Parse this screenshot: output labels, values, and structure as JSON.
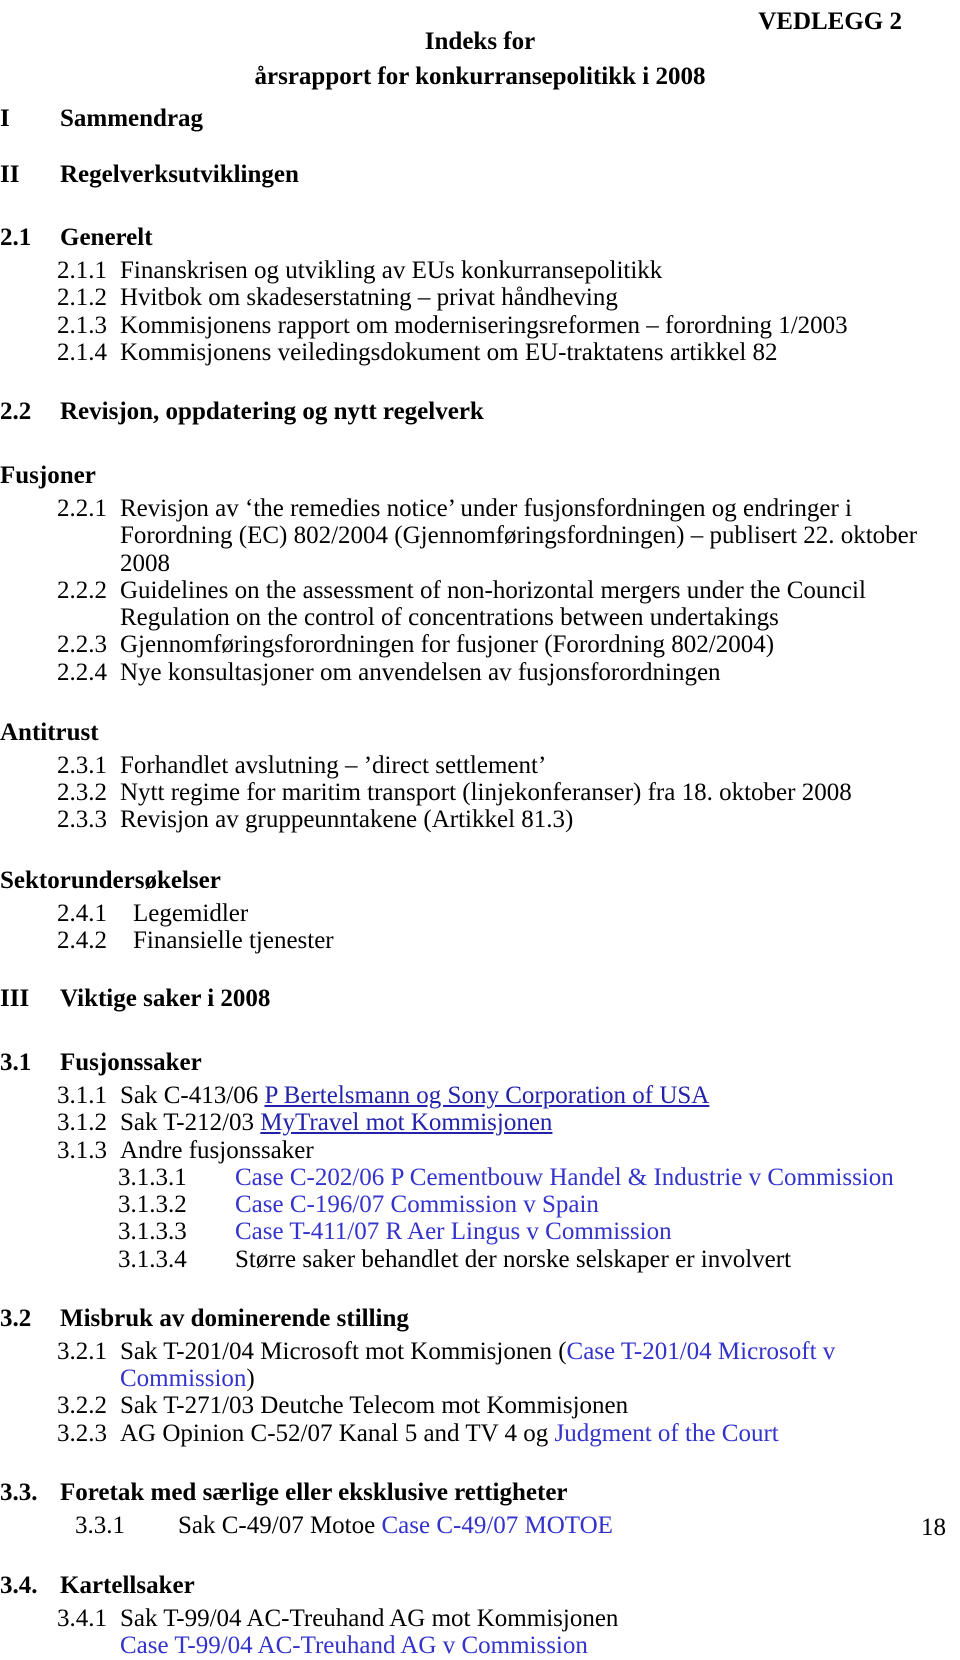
{
  "header": {
    "vedlegg": "VEDLEGG 2",
    "title_line1": "Indeks for",
    "title_line2": "årsrapport for konkurransepolitikk i 2008"
  },
  "colors": {
    "link_underlined": "#2222aa",
    "link_plain": "#3333cc",
    "text": "#000000",
    "background": "#ffffff"
  },
  "sections": {
    "roman_I": {
      "num": "I",
      "label": "Sammendrag"
    },
    "roman_II": {
      "num": "II",
      "label": "Regelverksutviklingen"
    },
    "roman_III": {
      "num": "III",
      "label": "Viktige saker i 2008"
    },
    "s21": {
      "num": "2.1",
      "label": "Generelt"
    },
    "s22": {
      "num": "2.2",
      "label": "Revisjon, oppdatering og nytt regelverk"
    },
    "s31": {
      "num": "3.1",
      "label": "Fusjonssaker"
    },
    "s32": {
      "num": "3.2",
      "label": "Misbruk av dominerende stilling"
    },
    "s33": {
      "num": "3.3.",
      "label": "Foretak med særlige eller eksklusive rettigheter"
    },
    "s34": {
      "num": "3.4.",
      "label": "Kartellsaker"
    }
  },
  "groups": {
    "fusjoner": "Fusjoner",
    "antitrust": "Antitrust",
    "sektor": "Sektorundersøkelser"
  },
  "items": {
    "i211": {
      "num": "2.1.1",
      "text": "Finanskrisen og utvikling av EUs konkurransepolitikk"
    },
    "i212": {
      "num": "2.1.2",
      "text": "Hvitbok om skadeserstatning – privat håndheving"
    },
    "i213": {
      "num": "2.1.3",
      "text": "Kommisjonens rapport om moderniseringsreformen – forordning 1/2003"
    },
    "i214": {
      "num": "2.1.4",
      "text": "Kommisjonens veiledingsdokument om EU-traktatens artikkel 82"
    },
    "i221": {
      "num": "2.2.1",
      "text": "Revisjon av ‘the remedies notice’ under fusjonsfordningen og endringer i Forordning (EC) 802/2004 (Gjennomføringsfordningen) – publisert 22. oktober 2008"
    },
    "i222": {
      "num": "2.2.2",
      "text": "Guidelines on the assessment of non-horizontal mergers under the Council Regulation on the control of concentrations between undertakings"
    },
    "i223": {
      "num": "2.2.3",
      "text": "Gjennomføringsforordningen for fusjoner (Forordning 802/2004)"
    },
    "i224": {
      "num": "2.2.4",
      "text": "Nye konsultasjoner om anvendelsen av fusjonsforordningen"
    },
    "i231": {
      "num": "2.3.1",
      "text": "Forhandlet avslutning – ’direct settlement’"
    },
    "i232": {
      "num": "2.3.2",
      "text": "Nytt regime for maritim transport (linjekonferanser) fra 18. oktober 2008"
    },
    "i233": {
      "num": "2.3.3",
      "text": "Revisjon av gruppeunntakene (Artikkel 81.3)"
    },
    "i241": {
      "num": "2.4.1",
      "text": "Legemidler"
    },
    "i242": {
      "num": "2.4.2",
      "text": "Finansielle tjenester"
    },
    "i311": {
      "num": "3.1.1",
      "text_pre": "Sak C-413/06 ",
      "link": "P Bertelsmann og Sony Corporation of USA"
    },
    "i312": {
      "num": "3.1.2",
      "text_pre": "Sak T-212/03 ",
      "link": "MyTravel mot Kommisjonen"
    },
    "i313": {
      "num": "3.1.3",
      "text": "Andre fusjonssaker"
    },
    "i3131": {
      "num": "3.1.3.1",
      "link": "Case C-202/06 P Cementbouw Handel & Industrie v Commission"
    },
    "i3132": {
      "num": "3.1.3.2",
      "link": "Case C-196/07 Commission v Spain"
    },
    "i3133": {
      "num": "3.1.3.3",
      "link": "Case T-411/07 R Aer Lingus v Commission"
    },
    "i3134": {
      "num": "3.1.3.4",
      "text": "Større saker behandlet der norske selskaper er involvert"
    },
    "i321": {
      "num": "3.2.1",
      "text_pre": "Sak T-201/04 Microsoft mot Kommisjonen (",
      "link": "Case T-201/04 Microsoft v Commission",
      "text_post": ")"
    },
    "i322": {
      "num": "3.2.2",
      "text": "Sak T-271/03 Deutche Telecom mot Kommisjonen"
    },
    "i323": {
      "num": "3.2.3",
      "text_pre": "AG Opinion C-52/07 Kanal 5 and TV 4 og ",
      "link": "Judgment of the Court"
    },
    "i331": {
      "num": "3.3.1",
      "text_pre": "Sak C-49/07 Motoe ",
      "link": "Case C-49/07 MOTOE"
    },
    "i341": {
      "num": "3.4.1",
      "text": "Sak T-99/04 AC-Treuhand AG mot Kommisjonen",
      "link": "Case T-99/04 AC-Treuhand AG v Commission"
    }
  },
  "footer": {
    "page_number": "18"
  }
}
